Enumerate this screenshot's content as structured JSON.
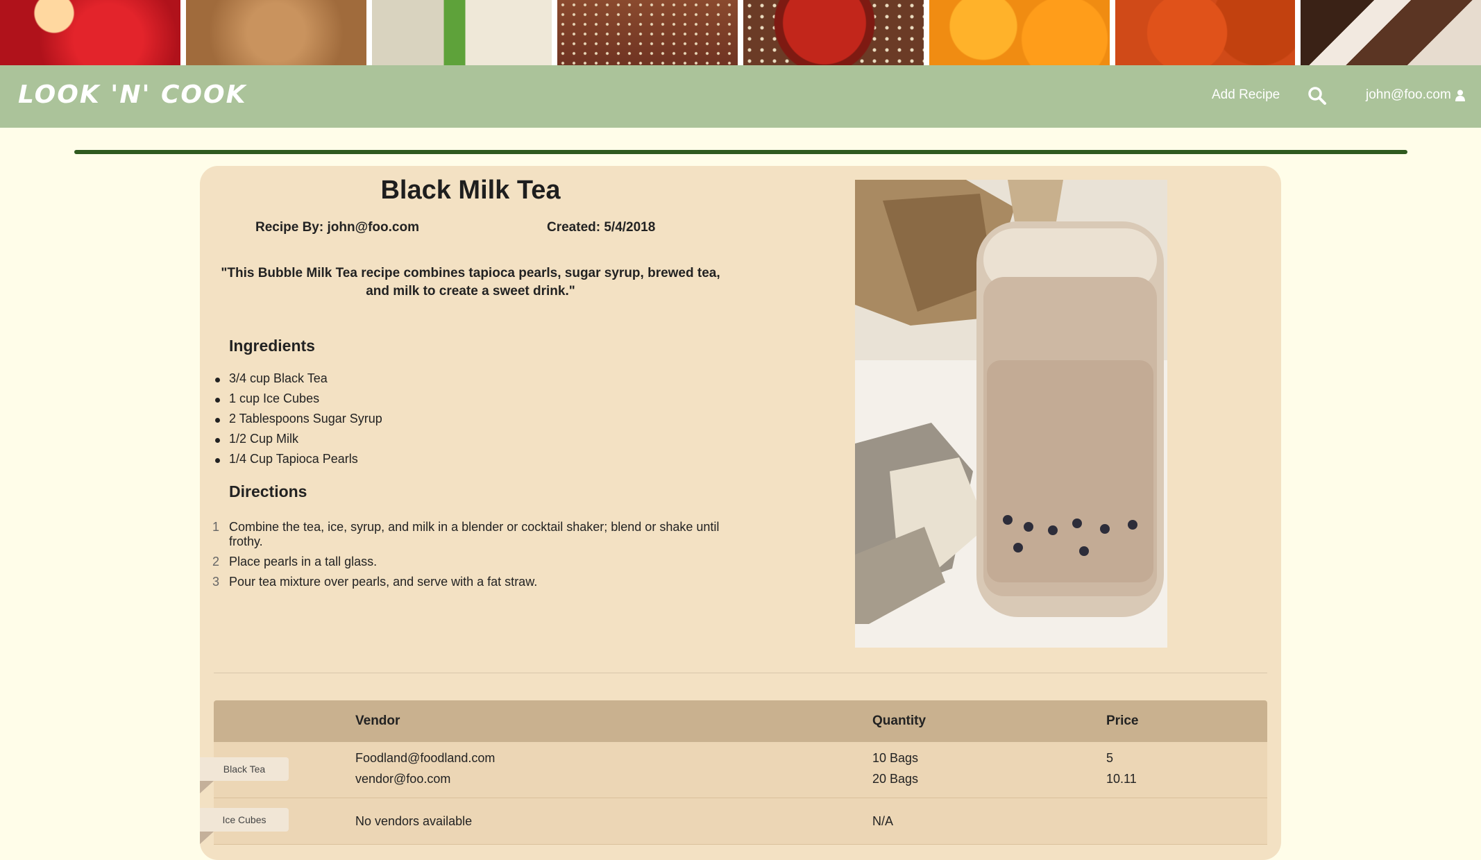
{
  "brand": {
    "logo": "LOOK 'N' COOK"
  },
  "nav": {
    "add_recipe": "Add Recipe",
    "user_email": "john@foo.com"
  },
  "recipe": {
    "title": "Black Milk Tea",
    "recipe_by": "Recipe By: john@foo.com",
    "created": "Created: 5/4/2018",
    "description": "\"This Bubble Milk Tea recipe combines tapioca pearls, sugar syrup, brewed tea, and milk to create a sweet drink.\"",
    "ingredients_heading": "Ingredients",
    "ingredients": [
      "3/4 cup Black Tea",
      "1 cup Ice Cubes",
      "2 Tablespoons Sugar Syrup",
      "1/2 Cup Milk",
      "1/4 Cup Tapioca Pearls"
    ],
    "directions_heading": "Directions",
    "directions": [
      {
        "num": "1",
        "text": "Combine the tea, ice, syrup, and milk in a blender or cocktail shaker; blend or shake until frothy."
      },
      {
        "num": "2",
        "text": "Place pearls in a tall glass."
      },
      {
        "num": "3",
        "text": "Pour tea mixture over pearls, and serve with a fat straw."
      }
    ]
  },
  "vendors": {
    "columns": [
      "Vendor",
      "Quantity",
      "Price"
    ],
    "rows": [
      {
        "ingredient": "Black Tea",
        "vendors": [
          "Foodland@foodland.com",
          "vendor@foo.com"
        ],
        "quantities": [
          "10 Bags",
          "20 Bags"
        ],
        "prices": [
          "5",
          "10.11"
        ]
      },
      {
        "ingredient": "Ice Cubes",
        "vendors": [
          "No vendors available"
        ],
        "quantities": [
          "N/A"
        ],
        "prices": []
      }
    ]
  },
  "colors": {
    "navbar": "#abc39a",
    "page_bg": "#fffde9",
    "card": "#f3e1c3",
    "rule": "#2f5a1f",
    "table_header": "#c9b18f"
  }
}
